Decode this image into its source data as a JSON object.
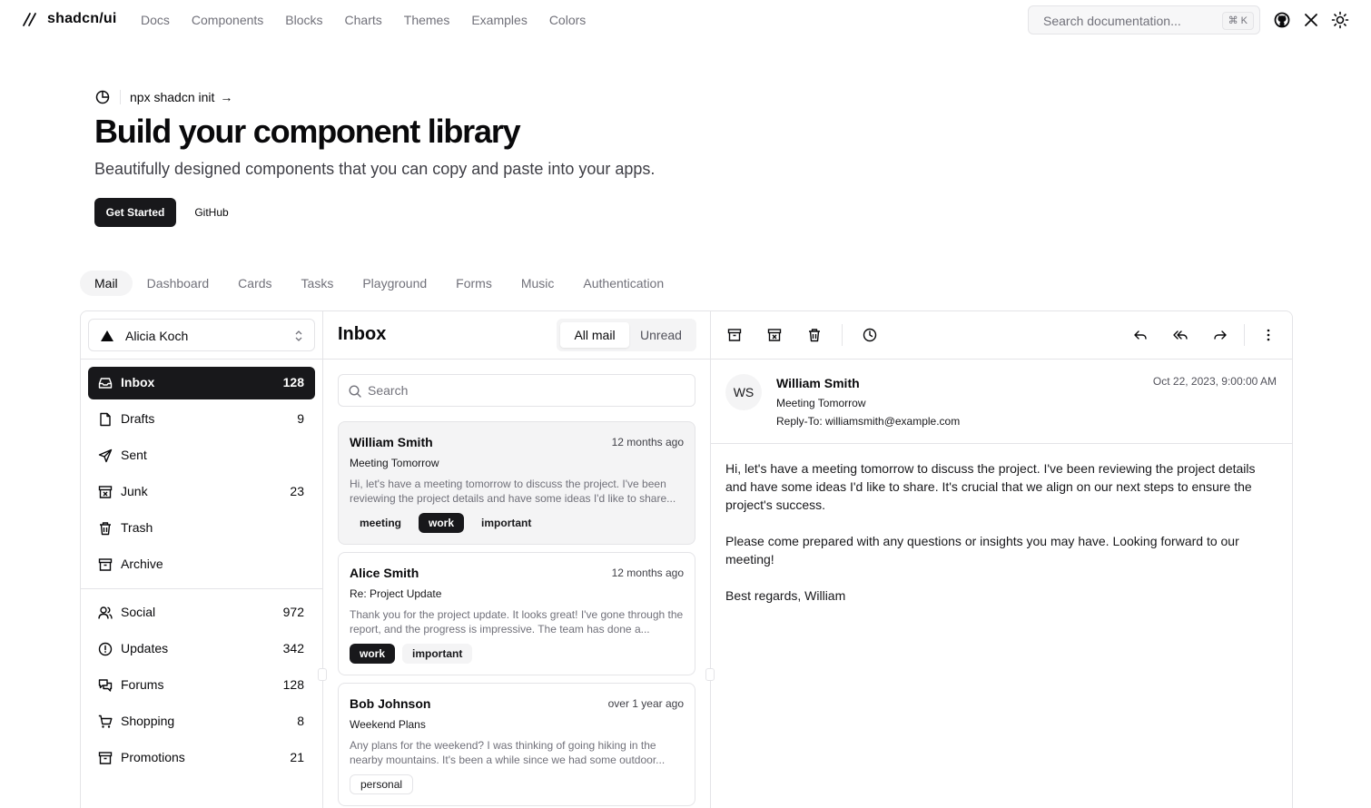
{
  "site": {
    "logo_text": "shadcn/ui"
  },
  "nav": {
    "links": [
      "Docs",
      "Components",
      "Blocks",
      "Charts",
      "Themes",
      "Examples",
      "Colors"
    ]
  },
  "search": {
    "placeholder": "Search documentation...",
    "shortcut": "⌘ K"
  },
  "hero": {
    "announcement": "npx shadcn init",
    "title": "Build your component library",
    "subtitle": "Beautifully designed components that you can copy and paste into your apps.",
    "primary_button": "Get Started",
    "secondary_button": "GitHub"
  },
  "example_tabs": {
    "items": [
      "Mail",
      "Dashboard",
      "Cards",
      "Tasks",
      "Playground",
      "Forms",
      "Music",
      "Authentication"
    ],
    "active": "Mail"
  },
  "mail": {
    "account": "Alicia Koch",
    "folders": [
      {
        "label": "Inbox",
        "count": "128",
        "icon": "inbox-icon"
      },
      {
        "label": "Drafts",
        "count": "9",
        "icon": "file-icon"
      },
      {
        "label": "Sent",
        "count": "",
        "icon": "send-icon"
      },
      {
        "label": "Junk",
        "count": "23",
        "icon": "archive-x-icon"
      },
      {
        "label": "Trash",
        "count": "",
        "icon": "trash-icon"
      },
      {
        "label": "Archive",
        "count": "",
        "icon": "archive-icon"
      }
    ],
    "categories": [
      {
        "label": "Social",
        "count": "972",
        "icon": "users-icon"
      },
      {
        "label": "Updates",
        "count": "342",
        "icon": "alert-circle-icon"
      },
      {
        "label": "Forums",
        "count": "128",
        "icon": "messages-icon"
      },
      {
        "label": "Shopping",
        "count": "8",
        "icon": "cart-icon"
      },
      {
        "label": "Promotions",
        "count": "21",
        "icon": "archive-icon"
      }
    ],
    "list": {
      "title": "Inbox",
      "filters": [
        "All mail",
        "Unread"
      ],
      "search_placeholder": "Search",
      "messages": [
        {
          "from": "William Smith",
          "when": "12 months ago",
          "subject": "Meeting Tomorrow",
          "snippet": "Hi, let's have a meeting tomorrow to discuss the project. I've been reviewing the project details and have some ideas I'd like to share...",
          "tags": [
            "meeting",
            "work",
            "important"
          ]
        },
        {
          "from": "Alice Smith",
          "when": "12 months ago",
          "subject": "Re: Project Update",
          "snippet": "Thank you for the project update. It looks great! I've gone through the report, and the progress is impressive. The team has done a...",
          "tags": [
            "work",
            "important"
          ]
        },
        {
          "from": "Bob Johnson",
          "when": "over 1 year ago",
          "subject": "Weekend Plans",
          "snippet": "Any plans for the weekend? I was thinking of going hiking in the nearby mountains. It's been a while since we had some outdoor...",
          "tags": [
            "personal"
          ]
        }
      ]
    },
    "reader": {
      "initials": "WS",
      "from": "William Smith",
      "subject": "Meeting Tomorrow",
      "reply_to": "Reply-To: williamsmith@example.com",
      "date": "Oct 22, 2023, 9:00:00 AM",
      "body": [
        "Hi, let's have a meeting tomorrow to discuss the project. I've been reviewing the project details and have some ideas I'd like to share. It's crucial that we align on our next steps to ensure the project's success.",
        "Please come prepared with any questions or insights you may have. Looking forward to our meeting!",
        "Best regards, William"
      ]
    }
  }
}
